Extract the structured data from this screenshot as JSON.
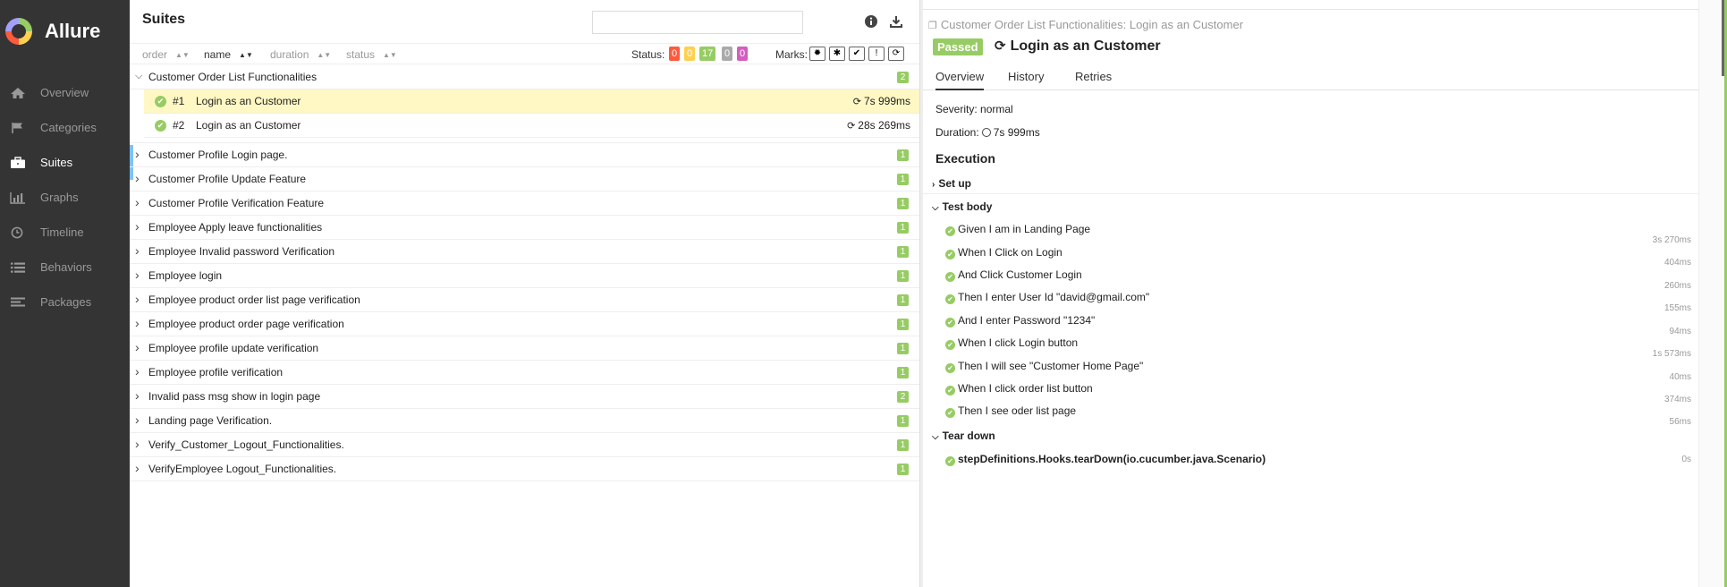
{
  "sidebar": {
    "logo_text": "Allure",
    "items": [
      {
        "label": "Overview",
        "icon": "home-icon"
      },
      {
        "label": "Categories",
        "icon": "flag-icon"
      },
      {
        "label": "Suites",
        "icon": "briefcase-icon"
      },
      {
        "label": "Graphs",
        "icon": "bar-chart-icon"
      },
      {
        "label": "Timeline",
        "icon": "clock-icon"
      },
      {
        "label": "Behaviors",
        "icon": "list-icon"
      },
      {
        "label": "Packages",
        "icon": "align-left-icon"
      }
    ],
    "active_item": "Suites"
  },
  "suites": {
    "title": "Suites",
    "search": {
      "value": "",
      "placeholder": ""
    },
    "sort": {
      "order": "order",
      "name": "name",
      "duration": "duration",
      "status": "status"
    },
    "status_label": "Status:",
    "status_counts": [
      {
        "value": "0",
        "color": "#fd5a3e"
      },
      {
        "value": "0",
        "color": "#ffd050"
      },
      {
        "value": "17",
        "color": "#97cc64"
      },
      {
        "value": "0",
        "color": "#aaaaaa"
      },
      {
        "value": "0",
        "color": "#d35ebe"
      }
    ],
    "marks_label": "Marks:",
    "marks": [
      "flaky",
      "new-failed",
      "new-passed",
      "new-broken",
      "retries"
    ],
    "expanded_group": {
      "name": "Customer Order List Functionalities",
      "count": "2",
      "tests": [
        {
          "num": "#1",
          "name": "Login as an Customer",
          "duration": "7s 999ms",
          "selected": true
        },
        {
          "num": "#2",
          "name": "Login as an Customer",
          "duration": "28s 269ms",
          "selected": false
        }
      ]
    },
    "groups": [
      {
        "name": "Customer Profile Login page.",
        "count": "1"
      },
      {
        "name": "Customer Profile Update Feature",
        "count": "1"
      },
      {
        "name": "Customer Profile Verification Feature",
        "count": "1"
      },
      {
        "name": "Employee Apply leave functionalities",
        "count": "1"
      },
      {
        "name": "Employee Invalid password Verification",
        "count": "1"
      },
      {
        "name": "Employee login",
        "count": "1"
      },
      {
        "name": "Employee product order list page verification",
        "count": "1"
      },
      {
        "name": "Employee product order page verification",
        "count": "1"
      },
      {
        "name": "Employee profile update verification",
        "count": "1"
      },
      {
        "name": "Employee profile verification",
        "count": "1"
      },
      {
        "name": "Invalid pass msg show in login page",
        "count": "2"
      },
      {
        "name": "Landing page Verification.",
        "count": "1"
      },
      {
        "name": "Verify_Customer_Logout_Functionalities.",
        "count": "1"
      },
      {
        "name": "VerifyEmployee Logout_Functionalities.",
        "count": "1"
      }
    ]
  },
  "detail": {
    "breadcrumb": "Customer Order List Functionalities: Login as an Customer",
    "status_badge": "Passed",
    "title": "Login as an Customer",
    "tabs": [
      "Overview",
      "History",
      "Retries"
    ],
    "severity": "Severity: normal",
    "duration_label": "Duration:",
    "duration_value": "7s 999ms",
    "execution_title": "Execution",
    "setup_label": "Set up",
    "body_label": "Test body",
    "steps": [
      {
        "name": "Given I am in Landing Page",
        "duration": "3s 270ms"
      },
      {
        "name": "When I Click on Login",
        "duration": "404ms"
      },
      {
        "name": "And Click Customer Login",
        "duration": "260ms"
      },
      {
        "name": "Then I enter User Id \"david@gmail.com\"",
        "duration": "155ms"
      },
      {
        "name": "And I enter Password \"1234\"",
        "duration": "94ms"
      },
      {
        "name": "When I click Login button",
        "duration": "1s 573ms"
      },
      {
        "name": "Then I will see \"Customer Home Page\"",
        "duration": "40ms"
      },
      {
        "name": "When I click order list button",
        "duration": "374ms"
      },
      {
        "name": "Then I see oder list page",
        "duration": "56ms"
      }
    ],
    "teardown_label": "Tear down",
    "teardown_step": {
      "name": "stepDefinitions.Hooks.tearDown(io.cucumber.java.Scenario)",
      "duration": "0s"
    }
  }
}
